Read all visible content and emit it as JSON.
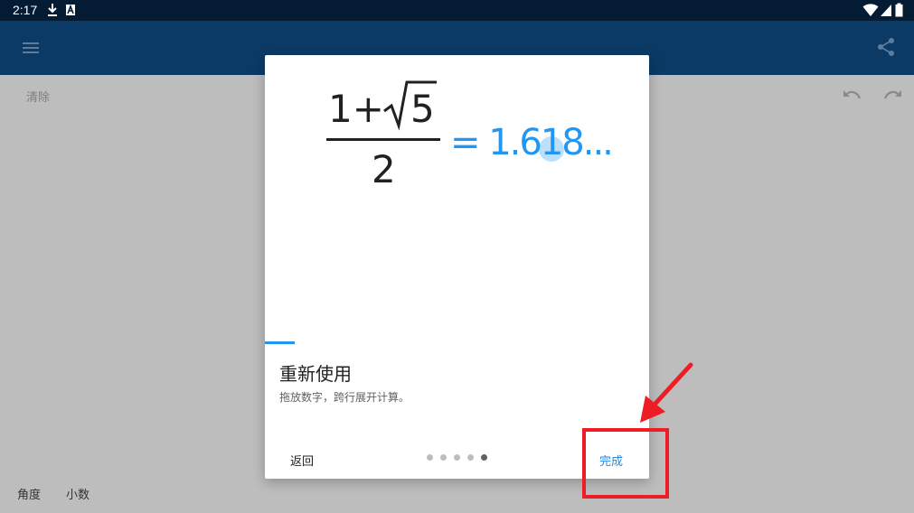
{
  "status_bar": {
    "time": "2:17",
    "icons": [
      "download-icon",
      "font-icon",
      "wifi-icon",
      "signal-icon",
      "battery-icon"
    ]
  },
  "app_bar": {
    "icons": [
      "menu-icon",
      "share-icon"
    ]
  },
  "background": {
    "clear_label": "清除",
    "bottom_labels": [
      "角度",
      "小数"
    ],
    "icons": [
      "undo-icon",
      "redo-icon"
    ]
  },
  "dialog": {
    "illustration": {
      "numerator_prefix": "1+",
      "radical_value": "5",
      "denominator": "2",
      "result": "= 1.618..."
    },
    "title": "重新使用",
    "description": "拖放数字，跨行展开计算。",
    "back_label": "返回",
    "done_label": "完成",
    "pager": {
      "total": 5,
      "active_index": 4
    }
  },
  "colors": {
    "accent": "#2196f3",
    "status_bar": "#041c33",
    "app_bar": "#0b3a66",
    "annotation": "#ee1c24"
  }
}
